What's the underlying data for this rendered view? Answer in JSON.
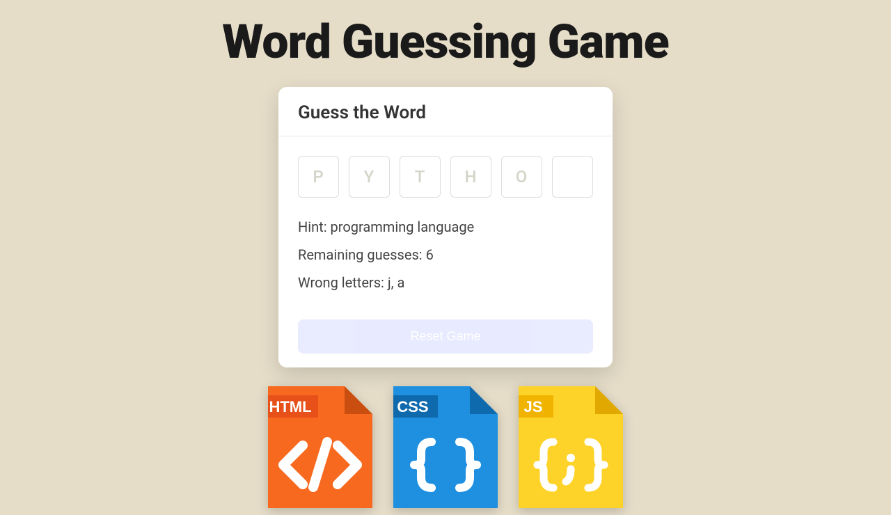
{
  "title": "Word Guessing Game",
  "card": {
    "heading": "Guess the Word",
    "letters": [
      "P",
      "Y",
      "T",
      "H",
      "O",
      ""
    ],
    "hint_label": "Hint:",
    "hint_value": "programming language",
    "remaining_label": "Remaining guesses:",
    "remaining_value": "6",
    "wrong_label": "Wrong letters:",
    "wrong_value": "j, a",
    "reset_label": "Reset Game"
  },
  "files": {
    "html": "HTML",
    "css": "CSS",
    "js": "JS"
  }
}
